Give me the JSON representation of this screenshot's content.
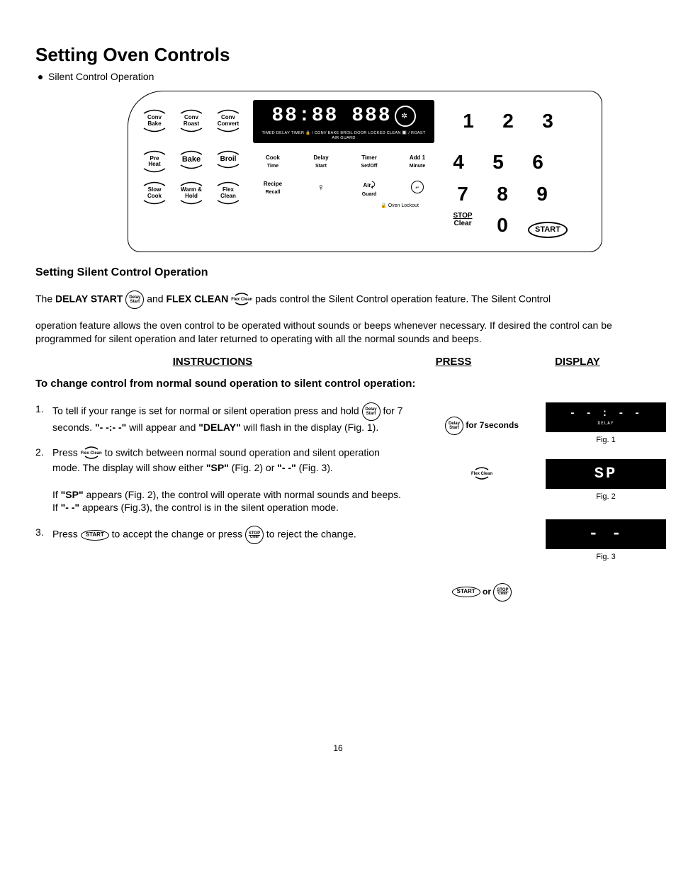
{
  "title": "Setting Oven Controls",
  "subtitle": "Silent Control Operation",
  "panel": {
    "modes": [
      [
        "Conv",
        "Bake"
      ],
      [
        "Conv",
        "Roast"
      ],
      [
        "Conv",
        "Convert"
      ],
      [
        "Pre",
        "Heat"
      ],
      [
        "Bake",
        ""
      ],
      [
        "Broil",
        ""
      ],
      [
        "Slow",
        "Cook"
      ],
      [
        "Warm &",
        "Hold"
      ],
      [
        "Flex",
        "Clean"
      ]
    ],
    "digits": "88:88 888",
    "disp_words": "TIMED  DELAY  TIMER  🔒  / CONV  BAKE  BROIL  DOOR  LOCKED  CLEAN  🔲  /  ROAST   AIR  GUARD",
    "funcs_r2": [
      [
        "Cook",
        "Time"
      ],
      [
        "Delay",
        "Start"
      ],
      [
        "Timer",
        "Set/Off"
      ],
      [
        "Add 1",
        "Minute"
      ]
    ],
    "funcs_r3": [
      [
        "Recipe",
        "Recall"
      ],
      [
        "💡",
        ""
      ],
      [
        "Air",
        "Guard"
      ],
      [
        "⏱",
        ""
      ]
    ],
    "keypad": [
      "1",
      "2",
      "3",
      "4",
      "5",
      "6",
      "7",
      "8",
      "9"
    ],
    "stop": "STOP",
    "clear": "Clear",
    "zero": "0",
    "start": "START",
    "lockout": "Oven Lockout"
  },
  "h2": "Setting Silent Control Operation",
  "intro_1a": "The ",
  "intro_1b": "DELAY START",
  "intro_1c": " and ",
  "intro_1d": "FLEX CLEAN",
  "intro_1e": " pads control the Silent Control operation feature. The Silent Control",
  "intro_2": "operation feature allows the oven control to be operated without sounds or beeps whenever necessary. If desired the control can be programmed for silent operation and later returned to operating with all the normal sounds and beeps.",
  "cols": {
    "instr": "INSTRUCTIONS",
    "press": "PRESS",
    "disp": "DISPLAY"
  },
  "h3": "To change control from normal sound operation to silent control operation:",
  "step1_a": "To tell if your range is set for normal or silent operation press and hold ",
  "step1_b": " for 7 seconds. ",
  "step1_c": "\"- -:- -\"",
  "step1_d": " will appear and ",
  "step1_e": "\"DELAY\"",
  "step1_f": " will flash in the display (Fig. 1).",
  "delaystart_label": "Delay Start",
  "press1": "for 7seconds",
  "step2_a": "Press ",
  "step2_b": " to switch between normal sound operation and silent operation mode. The display will show either ",
  "step2_c": "\"SP\"",
  "step2_d": " (Fig. 2) or ",
  "step2_e": "\"- -\"",
  "step2_f": " (Fig. 3).",
  "flexclean_label": "Flex Clean",
  "step2_note_a": "If ",
  "step2_note_b": "\"SP\"",
  "step2_note_c": " appears (Fig. 2), the control will operate with normal sounds and beeps.  If ",
  "step2_note_d": "\"- -\"",
  "step2_note_e": " appears (Fig.3), the control is in the silent operation mode.",
  "step3_a": "Press ",
  "step3_b": " to accept the change or press ",
  "step3_c": " to reject the change.",
  "start_label": "START",
  "stopclear_label": "STOP Clear",
  "or": "or",
  "fig1": {
    "text": "- - : - -",
    "delay": "DELAY",
    "label": "Fig. 1"
  },
  "fig2": {
    "text": "SP",
    "label": "Fig. 2"
  },
  "fig3": {
    "text": "- -",
    "label": "Fig. 3"
  },
  "pagenum": "16"
}
